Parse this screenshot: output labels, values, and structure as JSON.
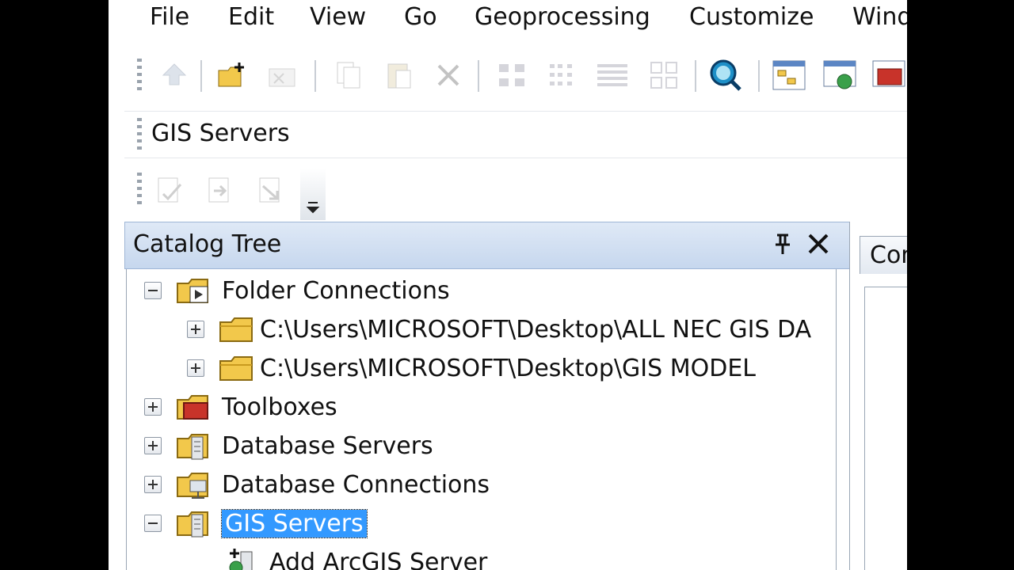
{
  "menu": [
    "File",
    "Edit",
    "View",
    "Go",
    "Geoprocessing",
    "Customize",
    "Windows"
  ],
  "location": {
    "value": "GIS Servers"
  },
  "panel": {
    "title": "Catalog Tree",
    "pin_icon": "pin-icon",
    "close_icon": "close-icon"
  },
  "tree": [
    {
      "label": "Folder Connections",
      "expander": "minus",
      "icon": "folder-connection-icon",
      "level": 0
    },
    {
      "label": "C:\\Users\\MICROSOFT\\Desktop\\ALL NEC GIS DA",
      "expander": "plus",
      "icon": "folder-icon",
      "level": 1
    },
    {
      "label": "C:\\Users\\MICROSOFT\\Desktop\\GIS MODEL",
      "expander": "plus",
      "icon": "folder-icon",
      "level": 1
    },
    {
      "label": "Toolboxes",
      "expander": "plus",
      "icon": "toolbox-icon",
      "level": 0
    },
    {
      "label": "Database Servers",
      "expander": "plus",
      "icon": "database-server-icon",
      "level": 0
    },
    {
      "label": "Database Connections",
      "expander": "plus",
      "icon": "database-connection-icon",
      "level": 0
    },
    {
      "label": "GIS Servers",
      "expander": "minus",
      "icon": "gis-server-icon",
      "level": 0,
      "selected": true
    },
    {
      "label": "Add ArcGIS Server",
      "icon": "add-server-icon",
      "level": 1
    }
  ],
  "right_panel": {
    "tab_label": "Con"
  },
  "colors": {
    "selection": "#3399ff",
    "header": "#c6d7ee",
    "edge": "#3a7bc8"
  }
}
